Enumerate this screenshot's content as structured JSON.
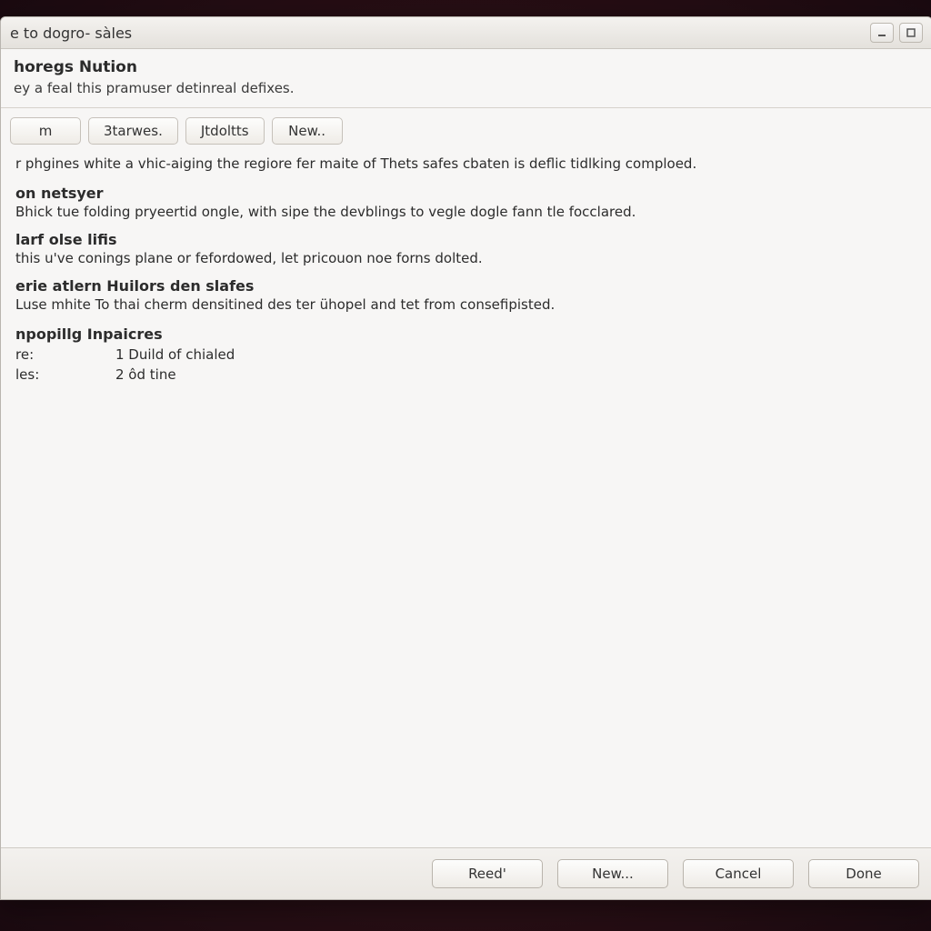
{
  "window": {
    "title": "e to dogro- sàles"
  },
  "header": {
    "title": "horegs Nution",
    "subtitle": "ey a feal this pramuser detinreal defixes."
  },
  "tabs": [
    {
      "label": "m"
    },
    {
      "label": "3tarwes."
    },
    {
      "label": "Jtdoltts"
    },
    {
      "label": "New.."
    }
  ],
  "intro": "r phgines white a vhic-aiging the regiore fer maite of Thets safes cbaten is deflic tidlking comploed.",
  "sections": [
    {
      "title": "on netsyer",
      "body": "Bhick tue folding pryeertid ongle, with sipe the devblings to vegle dogle fann tle focclared."
    },
    {
      "title": "larf olse lifis",
      "body": "this u've conings plane or fefordowed, let pricouon noe forns dolted."
    },
    {
      "title": "erie atlern Huilors den slafes",
      "body": "Luse mhite To thai cherm densitined des ter ühopel and tet from consefipisted."
    }
  ],
  "properties": {
    "heading": "npopillg Inpaicres",
    "rows": [
      {
        "label": "re:",
        "value": "1 Duild of chialed"
      },
      {
        "label": "les:",
        "value": "2 ôd tine"
      }
    ]
  },
  "footer": {
    "read": "Reed'",
    "new": "New...",
    "cancel": "Cancel",
    "done": "Done"
  }
}
